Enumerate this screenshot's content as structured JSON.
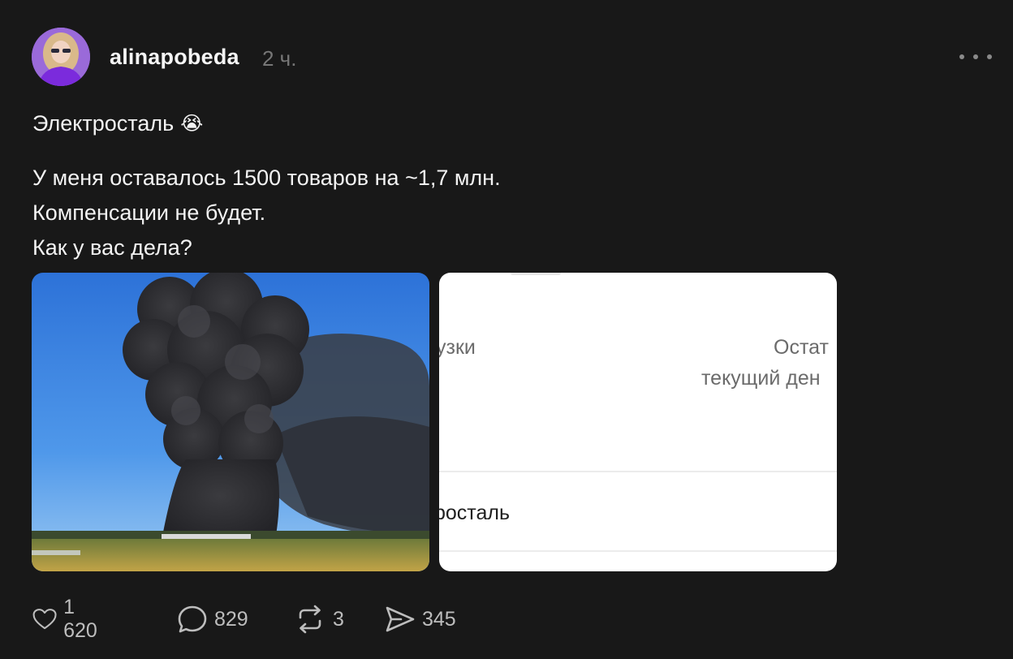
{
  "post": {
    "username": "alinapobeda",
    "time": "2 ч.",
    "title_text": "Электросталь",
    "title_emoji": "😭",
    "body_lines": [
      "У меня оставалось 1500 товаров на ~1,7 млн.",
      "Компенсации не будет.",
      "Как у вас дела?"
    ]
  },
  "media": {
    "photo_icon": "smoke-plume-photo",
    "screenshot_texts": [
      "узки",
      "Остат",
      "текущий ден",
      "росталь"
    ]
  },
  "actions": {
    "likes": "1 620",
    "comments": "829",
    "reposts": "3",
    "shares": "345"
  },
  "icons": {
    "like": "heart-icon",
    "comment": "speech-bubble-icon",
    "repost": "repost-icon",
    "share": "send-icon",
    "more": "more-horizontal-icon"
  },
  "colors": {
    "background": "#181818",
    "text": "#f3f3f3",
    "muted": "#777777"
  }
}
